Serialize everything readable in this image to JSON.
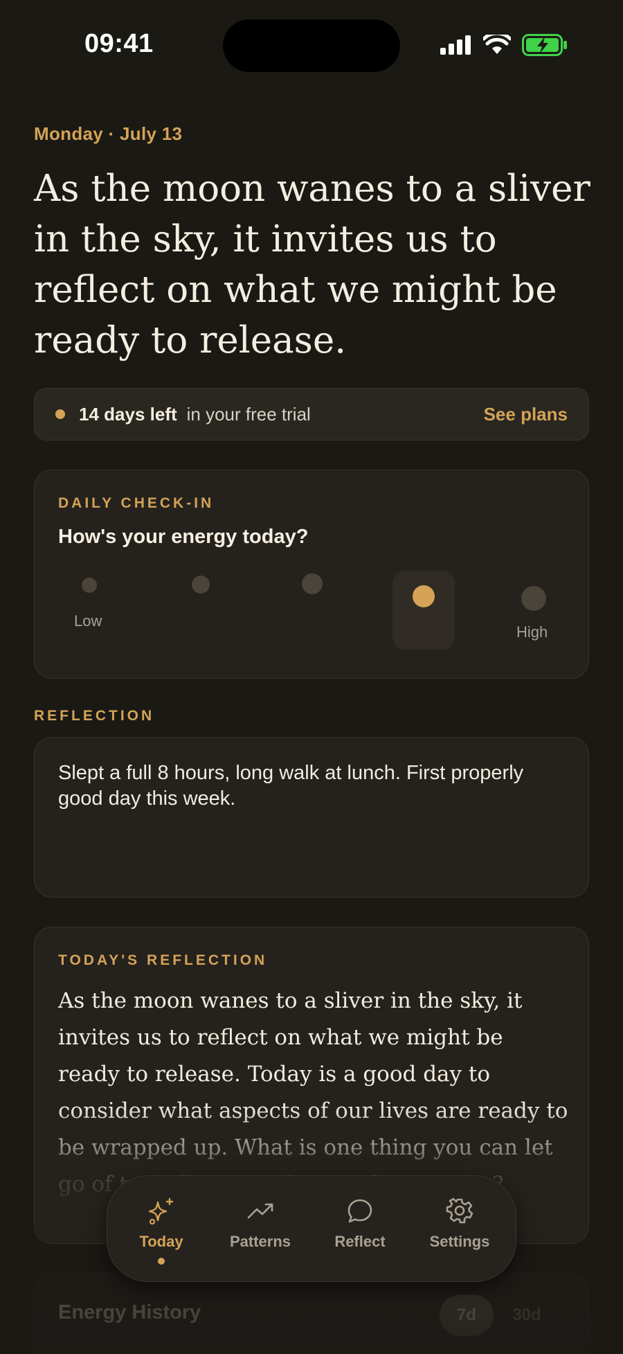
{
  "status_bar": {
    "time": "09:41"
  },
  "header": {
    "date": "Monday · July 13",
    "headline": "As the moon wanes to a sliver in the sky, it invites us to reflect on what we might be ready to release."
  },
  "trial": {
    "days_left": "14 days left",
    "suffix": "in your free trial",
    "link": "See plans"
  },
  "checkin": {
    "eyebrow": "DAILY CHECK-IN",
    "question": "How's your energy today?",
    "low_label": "Low",
    "high_label": "High",
    "levels": 5,
    "selected_level": 4
  },
  "reflection": {
    "label": "REFLECTION",
    "text": "Slept a full 8 hours, long walk at lunch. First properly good day this week."
  },
  "todays_reflection": {
    "eyebrow": "TODAY'S REFLECTION",
    "body": "As the moon wanes to a sliver in the sky, it invites us to reflect on what we might be ready to release. Today is a good day to consider what aspects of our lives are ready to be wrapped up. What is one thing you can let go of to make space for new beginnings?"
  },
  "energy_history": {
    "title": "Energy History",
    "options": [
      "7d",
      "30d"
    ],
    "selected": "7d"
  },
  "tabbar": {
    "tabs": [
      {
        "label": "Today",
        "icon": "sparkles-icon",
        "active": true
      },
      {
        "label": "Patterns",
        "icon": "trending-up-icon",
        "active": false
      },
      {
        "label": "Reflect",
        "icon": "chat-bubble-icon",
        "active": false
      },
      {
        "label": "Settings",
        "icon": "gear-icon",
        "active": false
      }
    ]
  },
  "colors": {
    "background": "#1b1914",
    "card": "#25221d",
    "accent": "#d4a356",
    "text": "#f2ece0",
    "muted": "#a8a194",
    "battery": "#3fd34a"
  }
}
